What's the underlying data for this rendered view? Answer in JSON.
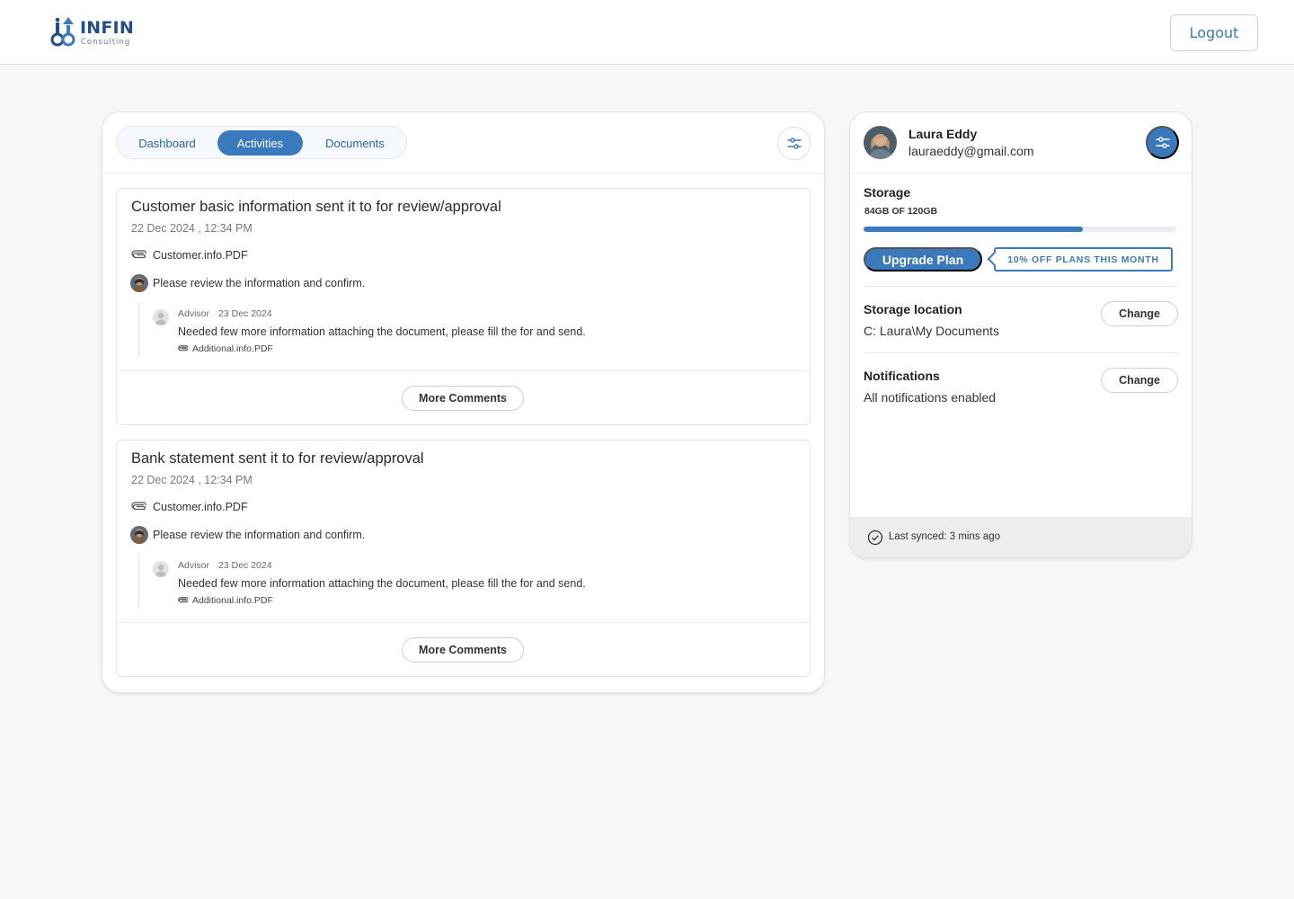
{
  "brand": {
    "name": "INFIN",
    "tagline": "Consulting"
  },
  "header": {
    "logout_label": "Logout"
  },
  "tabs": [
    {
      "label": "Dashboard",
      "active": false
    },
    {
      "label": "Activities",
      "active": true
    },
    {
      "label": "Documents",
      "active": false
    }
  ],
  "activities": [
    {
      "title": "Customer basic information sent it to for review/approval",
      "date": "22 Dec 2024 , 12:34 PM",
      "attachment": "Customer.info.PDF",
      "message": "Please review the information and confirm.",
      "reply": {
        "author": "Advisor",
        "date": "23 Dec 2024",
        "text": "Needed few more information attaching the document, please fill the for and send.",
        "attachment": "Additional.info.PDF"
      },
      "more_label": "More Comments"
    },
    {
      "title": "Bank statement sent it to for review/approval",
      "date": "22 Dec 2024 , 12:34 PM",
      "attachment": "Customer.info.PDF",
      "message": "Please review the information and confirm.",
      "reply": {
        "author": "Advisor",
        "date": "23 Dec 2024",
        "text": "Needed few more information attaching the document, please fill the for and send.",
        "attachment": "Additional.info.PDF"
      },
      "more_label": "More Comments"
    }
  ],
  "profile": {
    "name": "Laura Eddy",
    "email": "lauraeddy@gmail.com"
  },
  "storage": {
    "title": "Storage",
    "amount": "84GB OF 120GB",
    "used_fraction": 0.7,
    "upgrade_label": "Upgrade Plan",
    "promo": "10% OFF PLANS THIS MONTH"
  },
  "settings": {
    "location": {
      "title": "Storage location",
      "value": "C: Laura\\My Documents",
      "action": "Change"
    },
    "notifications": {
      "title": "Notifications",
      "value": "All notifications enabled",
      "action": "Change"
    }
  },
  "sync": {
    "text": "Last synced: 3 mins ago"
  },
  "colors": {
    "accent": "#3b79bd",
    "brand_dark": "#1f4e8c"
  },
  "icons": {
    "logo": "infin-logo-icon",
    "filter": "sliders-icon",
    "settings": "sliders-icon",
    "attachment": "paperclip-icon",
    "sync": "check-circle-icon"
  }
}
